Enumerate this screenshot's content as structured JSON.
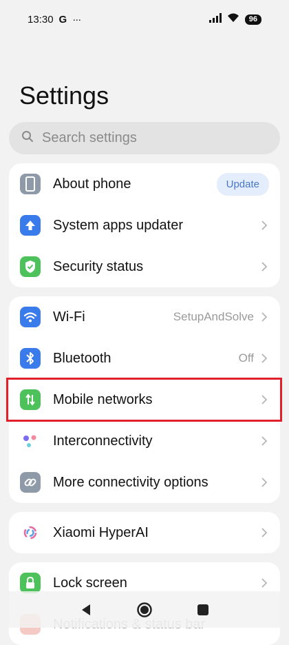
{
  "status_bar": {
    "time": "13:30",
    "carrier_glyph": "G",
    "more_glyph": "···",
    "battery_level": "96",
    "icons": [
      "signal-icon",
      "wifi-icon",
      "battery-icon"
    ]
  },
  "page": {
    "title": "Settings"
  },
  "search": {
    "placeholder": "Search settings"
  },
  "card1": {
    "items": [
      {
        "label": "About phone",
        "icon": "phone-icon",
        "icon_color": "#8e9aa8",
        "action_label": "Update"
      },
      {
        "label": "System apps updater",
        "icon": "arrow-up-icon",
        "icon_color": "#3a7bec"
      },
      {
        "label": "Security status",
        "icon": "shield-check-icon",
        "icon_color": "#4dc25a"
      }
    ]
  },
  "card2": {
    "items": [
      {
        "label": "Wi-Fi",
        "icon": "wifi-icon",
        "icon_color": "#3a7bec",
        "value": "SetupAndSolve"
      },
      {
        "label": "Bluetooth",
        "icon": "bluetooth-icon",
        "icon_color": "#3a7bec",
        "value": "Off"
      },
      {
        "label": "Mobile networks",
        "icon": "mobile-data-icon",
        "icon_color": "#4dc25a"
      },
      {
        "label": "Interconnectivity",
        "icon": "interconnectivity-icon"
      },
      {
        "label": "More connectivity options",
        "icon": "link-icon",
        "icon_color": "#8e9aa8"
      }
    ]
  },
  "card3": {
    "items": [
      {
        "label": "Xiaomi HyperAI",
        "icon": "hyperai-icon"
      }
    ]
  },
  "card4": {
    "items": [
      {
        "label": "Lock screen",
        "icon": "lock-icon",
        "icon_color": "#4dc25a"
      },
      {
        "label": "Notifications & status bar",
        "icon": "notification-icon",
        "icon_color": "#e86a5a"
      }
    ]
  },
  "colors": {
    "highlight": "#e0202a",
    "accent": "#4a78c8"
  }
}
